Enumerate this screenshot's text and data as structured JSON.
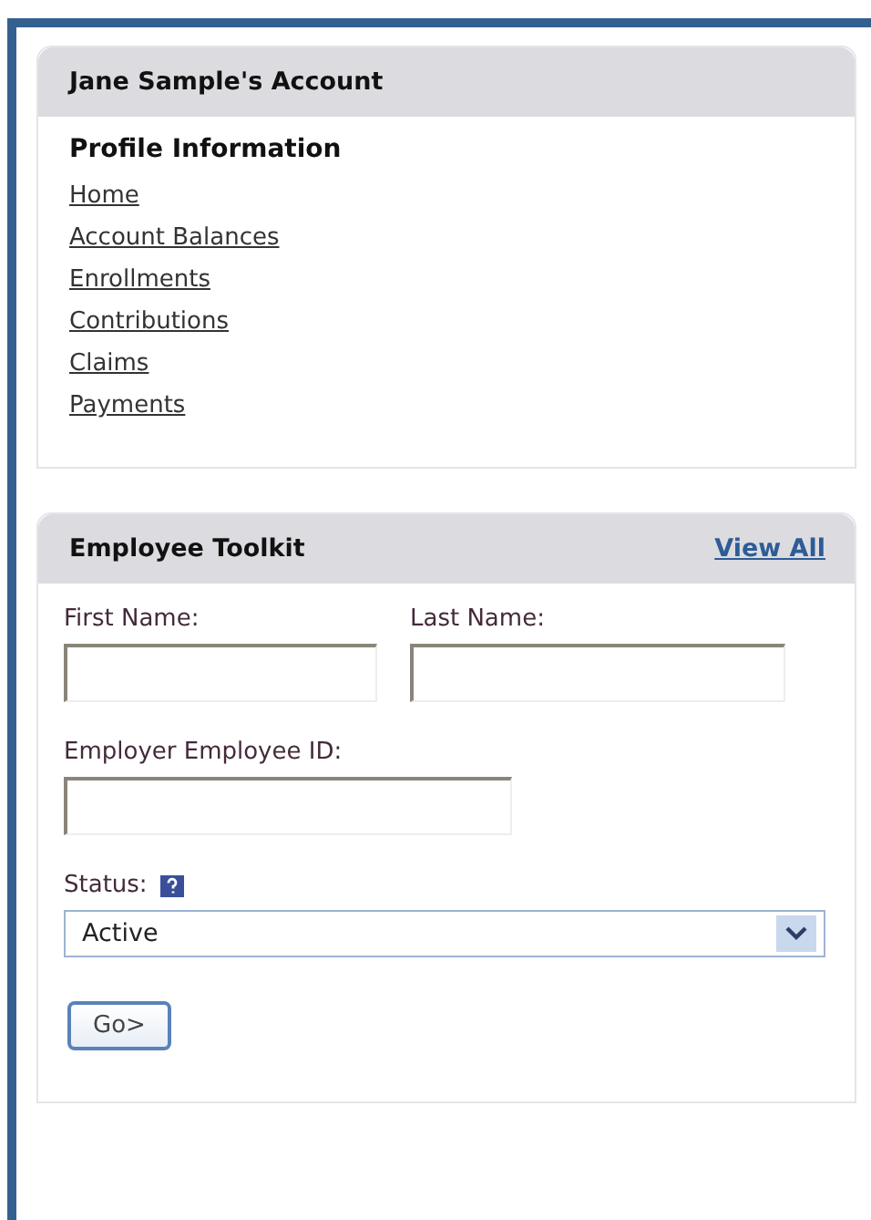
{
  "account_panel": {
    "title": "Jane Sample's Account",
    "section_heading": "Profile Information",
    "links": [
      {
        "label": "Home"
      },
      {
        "label": "Account Balances"
      },
      {
        "label": "Enrollments"
      },
      {
        "label": "Contributions"
      },
      {
        "label": "Claims"
      },
      {
        "label": "Payments"
      }
    ]
  },
  "toolkit_panel": {
    "title": "Employee Toolkit",
    "view_all": "View All",
    "first_name": {
      "label": "First Name:"
    },
    "last_name": {
      "label": "Last Name:"
    },
    "employee_id": {
      "label": "Employer Employee ID:"
    },
    "status": {
      "label": "Status:",
      "value": "Active"
    },
    "go_button": "Go>"
  }
}
